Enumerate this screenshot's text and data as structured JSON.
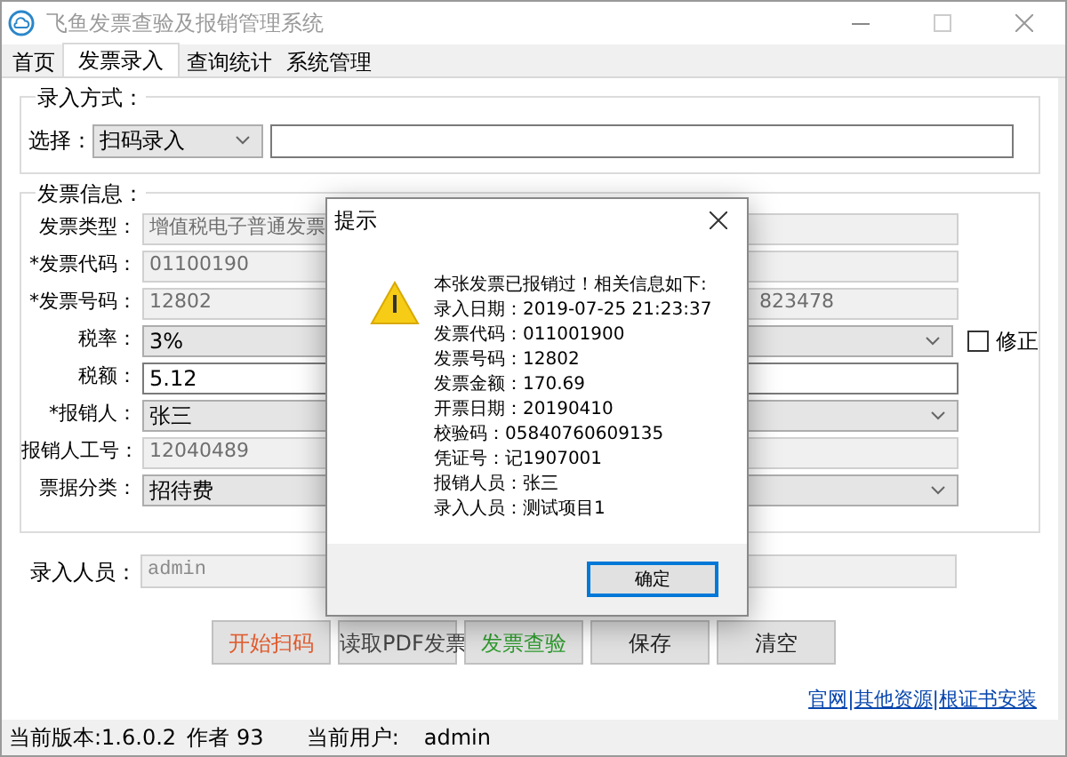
{
  "window": {
    "title": "飞鱼发票查验及报销管理系统"
  },
  "tabs": [
    {
      "label": "首页",
      "selected": false
    },
    {
      "label": "发票录入",
      "selected": true
    },
    {
      "label": "查询统计",
      "selected": false
    },
    {
      "label": "系统管理",
      "selected": false
    }
  ],
  "entry_method": {
    "legend": "录入方式：",
    "label": "选择：",
    "select": "扫码录入"
  },
  "invoice_info": {
    "legend": "发票信息：",
    "fields": [
      {
        "label": "发票类型：",
        "value": "增值税电子普通发票",
        "kind": "readonly"
      },
      {
        "label": "*发票代码：",
        "value": "01100190",
        "kind": "readonly"
      },
      {
        "label": "*发票号码：",
        "value": "12802",
        "extra": "823478",
        "kind": "readonly"
      },
      {
        "label": "税率：",
        "value": "3%",
        "kind": "select"
      },
      {
        "label": "税额：",
        "value": "5.12",
        "kind": "text"
      },
      {
        "label": "*报销人：",
        "value": "张三",
        "kind": "select"
      },
      {
        "label": "报销人工号：",
        "value": "12040489",
        "kind": "readonly"
      },
      {
        "label": "票据分类：",
        "value": "招待费",
        "kind": "select"
      }
    ],
    "correction": {
      "label": "修正",
      "checked": false
    }
  },
  "entry_person": {
    "label": "录入人员：",
    "value": "admin"
  },
  "buttons": [
    {
      "label": "开始扫码",
      "color": "#e0592b"
    },
    {
      "label": "读取PDF发票",
      "color": "#444444"
    },
    {
      "label": "发票查验",
      "color": "#2e9b2e"
    },
    {
      "label": "保存",
      "color": "#222222"
    },
    {
      "label": "清空",
      "color": "#222222"
    }
  ],
  "links": {
    "items": [
      "官网",
      "其他资源",
      "根证书安装"
    ],
    "separator": "|"
  },
  "status_bar": [
    {
      "text": "当前版本:1.6.0.2"
    },
    {
      "text": "作者"
    },
    {
      "text": "93"
    },
    {
      "text": "当前用户:"
    },
    {
      "text": "admin"
    }
  ],
  "dialog": {
    "title": "提示",
    "lines": [
      "本张发票已报销过！相关信息如下:",
      "录入日期：2019-07-25 21:23:37",
      "发票代码：011001900",
      "发票号码：12802",
      "发票金额：170.69",
      "开票日期：20190410",
      "校验码：05840760609135",
      "凭证号：记1907001",
      "报销人员：张三",
      "录入人员：测试项目1"
    ],
    "ok": "确定"
  }
}
